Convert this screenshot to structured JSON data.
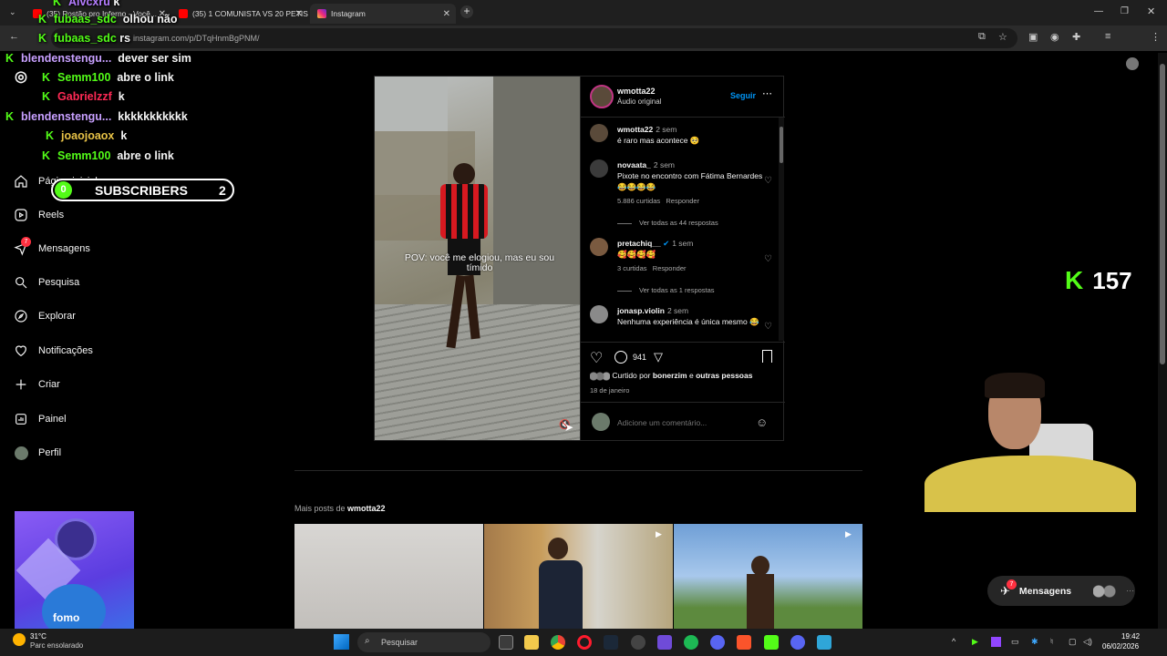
{
  "browser": {
    "tabs": [
      {
        "title": "(35) Postão pro Inferno - Você..."
      },
      {
        "title": "(35) 1 COMUNISTA VS 20 PETIS..."
      },
      {
        "title": "Instagram"
      }
    ],
    "url": "instagram.com/p/DTqHnmBgPNM/"
  },
  "sidebar": {
    "items": [
      {
        "label": "Página inicial",
        "icon": "home-icon"
      },
      {
        "label": "Reels",
        "icon": "reels-icon"
      },
      {
        "label": "Mensagens",
        "icon": "messages-icon",
        "badge": "7"
      },
      {
        "label": "Pesquisa",
        "icon": "search-icon"
      },
      {
        "label": "Explorar",
        "icon": "compass-icon"
      },
      {
        "label": "Notificações",
        "icon": "heart-icon"
      },
      {
        "label": "Criar",
        "icon": "plus-icon"
      },
      {
        "label": "Painel",
        "icon": "chart-icon"
      },
      {
        "label": "Perfil",
        "icon": "avatar-icon"
      }
    ]
  },
  "overlay": {
    "chat": [
      {
        "user": "Aivcxru",
        "msg": "k",
        "color": "#b57dff"
      },
      {
        "user": "fubaas_sdc",
        "msg": "olhou não",
        "color": "#53fc18"
      },
      {
        "user": "fubaas_sdc",
        "msg": "rs",
        "color": "#53fc18"
      },
      {
        "user": "blendenstengu...",
        "msg": "dever ser sim",
        "color": "#c8a0ff"
      },
      {
        "user": "Semm100",
        "msg": "abre o link",
        "color": "#53fc18"
      },
      {
        "user": "Gabrielzzf",
        "msg": "k",
        "color": "#ff2a55"
      },
      {
        "user": "blendenstengu...",
        "msg": "kkkkkkkkkkk",
        "color": "#c8a0ff"
      },
      {
        "user": "joaojoaox",
        "msg": "k",
        "color": "#e8c347"
      },
      {
        "user": "Semm100",
        "msg": "abre o link",
        "color": "#53fc18"
      }
    ],
    "subs_left": "0",
    "subs_label": "SUBSCRIBERS",
    "subs_right": "2",
    "viewers": "157",
    "fomo_label": "fomo"
  },
  "post": {
    "username": "wmotta22",
    "audio": "Áudio original",
    "follow": "Seguir",
    "video_caption": "POV: você me elogiou, mas eu sou tímido",
    "comments": [
      {
        "user": "wmotta22",
        "time": "2 sem",
        "text": "é raro mas acontece 🥺"
      },
      {
        "user": "novaata_",
        "time": "2 sem",
        "text": "Pixote no encontro com Fátima Bernardes 😂😂😂😂",
        "likes": "5.886 curtidas",
        "reply": "Responder",
        "more": "Ver todas as 44 respostas"
      },
      {
        "user": "pretachiq__",
        "time": "1 sem",
        "text": "🥰🥰🥰🥰",
        "likes": "3 curtidas",
        "reply": "Responder",
        "more": "Ver todas as 1 respostas"
      },
      {
        "user": "jonasp.violin",
        "time": "2 sem",
        "text": "Nenhuma experiência é única mesmo 😂"
      }
    ],
    "comment_count": "941",
    "liked_by_prefix": "Curtido por",
    "liked_by_user": "bonerzim",
    "liked_by_suffix": "e",
    "liked_by_others": "outras pessoas",
    "date": "18 de janeiro",
    "add_comment_placeholder": "Adicione um comentário..."
  },
  "more_posts": {
    "prefix": "Mais posts de",
    "user": "wmotta22"
  },
  "messages_fab": {
    "label": "Mensagens",
    "badge": "7"
  },
  "taskbar": {
    "weather_temp": "31°C",
    "weather_desc": "Parc ensolarado",
    "search_placeholder": "Pesquisar",
    "time": "19:42",
    "date": "06/02/2026"
  },
  "colors": {
    "kick_green": "#53fc18",
    "ig_blue": "#0095f6",
    "badge_red": "#ff3040"
  }
}
